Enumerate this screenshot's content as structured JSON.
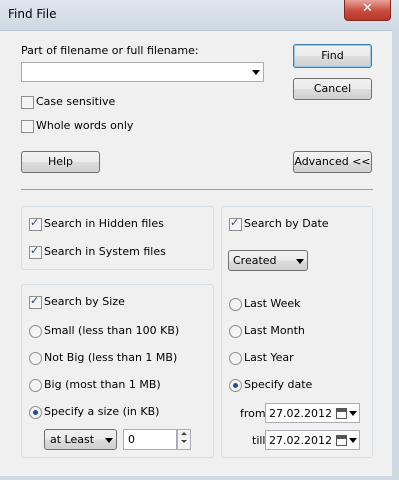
{
  "window": {
    "title": "Find File",
    "close_glyph": "✕"
  },
  "main": {
    "filename_label": "Part of filename or full filename:",
    "filename_value": "",
    "case_sensitive": {
      "label": "Case sensitive",
      "checked": false
    },
    "whole_words": {
      "label": "Whole words only",
      "checked": false
    },
    "find_button": "Find",
    "cancel_button": "Cancel",
    "help_button": "Help",
    "advanced_button": "Advanced <<"
  },
  "hidden_system": {
    "hidden": {
      "label": "Search in Hidden files",
      "checked": true
    },
    "system": {
      "label": "Search in System files",
      "checked": true
    }
  },
  "size": {
    "enabled": {
      "label": "Search by Size",
      "checked": true
    },
    "options": [
      {
        "label": "Small (less than 100 KB)",
        "selected": false
      },
      {
        "label": "Not Big (less than 1 MB)",
        "selected": false
      },
      {
        "label": "Big (most than 1 MB)",
        "selected": false
      },
      {
        "label": "Specify a size (in KB)",
        "selected": true
      }
    ],
    "comparison_value": "at Least",
    "size_value": "0"
  },
  "date": {
    "enabled": {
      "label": "Search by Date",
      "checked": true
    },
    "type_value": "Created",
    "options": [
      {
        "label": "Last Week",
        "selected": false
      },
      {
        "label": "Last Month",
        "selected": false
      },
      {
        "label": "Last Year",
        "selected": false
      },
      {
        "label": "Specify date",
        "selected": true
      }
    ],
    "from_label": "from",
    "from_value": "27.02.2012",
    "till_label": "till",
    "till_value": "27.02.2012"
  },
  "colors": {
    "titlebar": "#cfd9e4",
    "close": "#c94b3b",
    "default_button_border": "#3c7fb1",
    "dialog_bg": "#f0f0f0"
  }
}
